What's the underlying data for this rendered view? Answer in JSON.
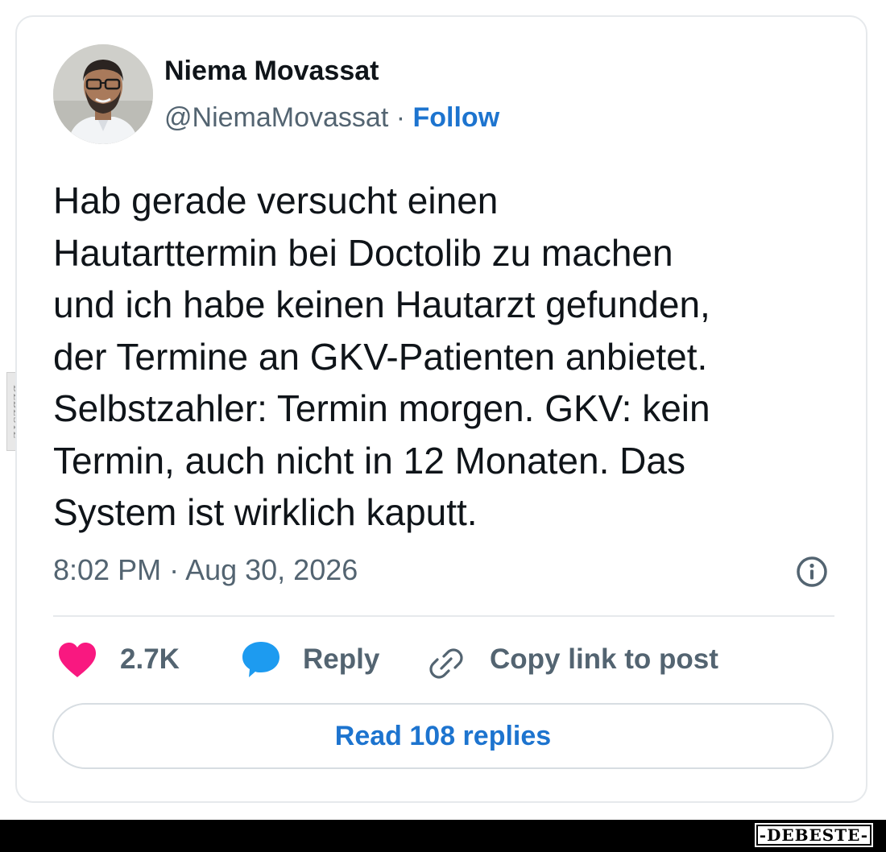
{
  "watermark": {
    "side_text": "DEBESTE",
    "brand": "-DEBESTE-"
  },
  "author": {
    "name": "Niema Movassat",
    "handle": "@NiemaMovassat",
    "separator": "·",
    "follow_label": "Follow"
  },
  "tweet": {
    "lines": [
      "Hab gerade versucht einen",
      "Hautarttermin bei Doctolib zu machen",
      "und ich habe keinen Hautarzt gefunden,",
      "der Termine an GKV-Patienten anbietet.",
      "Selbstzahler: Termin morgen. GKV: kein",
      "Termin, auch nicht in 12 Monaten. Das",
      "System ist wirklich kaputt."
    ],
    "timestamp": "8:02 PM · Aug 30, 2026"
  },
  "actions": {
    "like_count": "2.7K",
    "reply_label": "Reply",
    "copy_label": "Copy link to post"
  },
  "read_replies_label": "Read 108 replies",
  "icons": {
    "like": "heart-icon",
    "reply": "speech-bubble-icon",
    "copy": "link-icon",
    "info": "info-icon"
  },
  "colors": {
    "like": "#f91880",
    "reply_icon": "#1d9bf0",
    "link_blue": "#1d74cf",
    "muted": "#536471",
    "text": "#0f1419"
  }
}
